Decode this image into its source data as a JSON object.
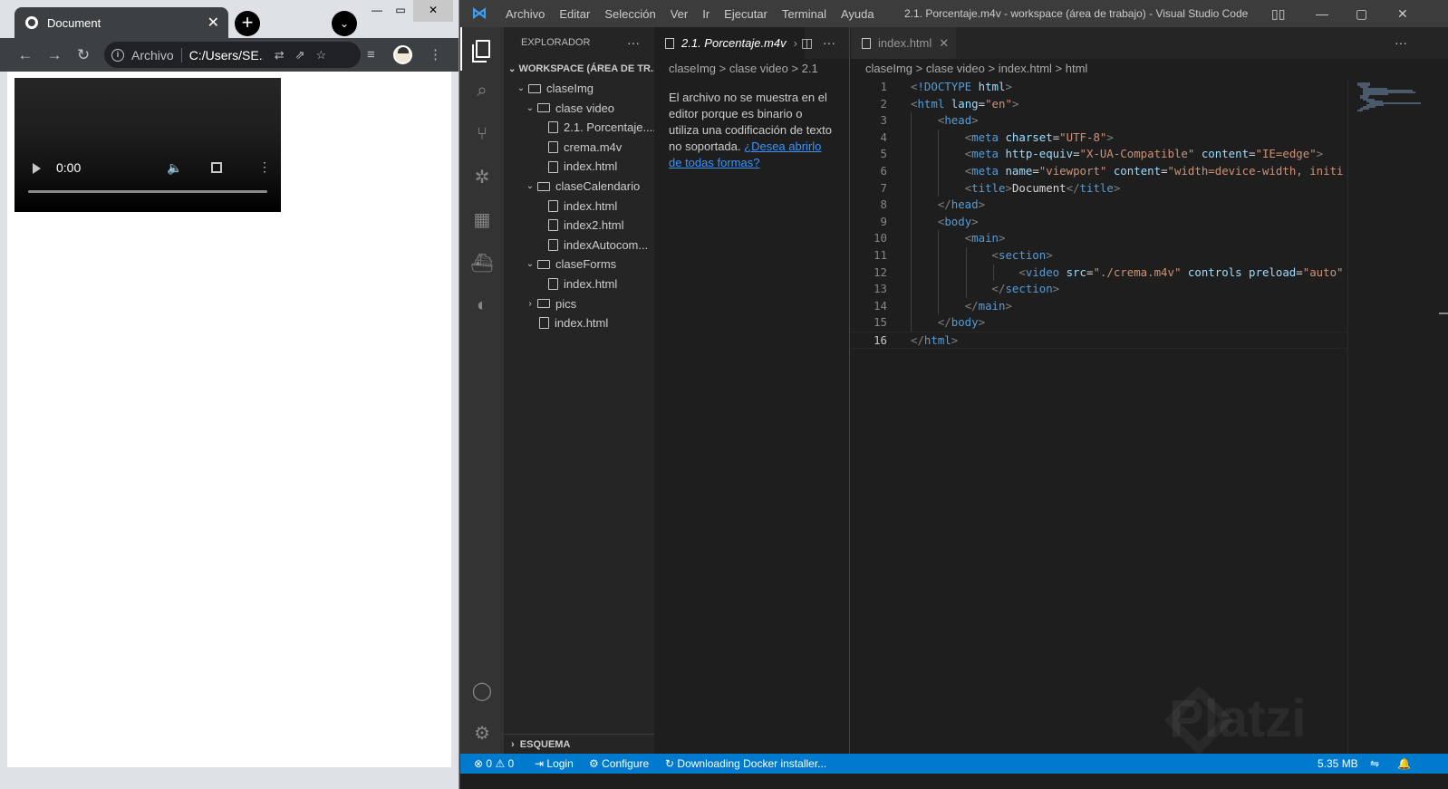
{
  "browser": {
    "tab_title": "Document",
    "address_label": "Archivo",
    "address_url": "C:/Users/SE...",
    "video": {
      "time": "0:00"
    }
  },
  "vscode": {
    "menu": [
      "Archivo",
      "Editar",
      "Selección",
      "Ver",
      "Ir",
      "Ejecutar",
      "Terminal",
      "Ayuda"
    ],
    "window_title": "2.1. Porcentaje.m4v - workspace (área de trabajo) - Visual Studio Code",
    "explorer": {
      "title": "EXPLORADOR",
      "workspace": "WORKSPACE (ÁREA DE TR...",
      "tree": [
        {
          "label": "claseImg",
          "type": "root-folder",
          "depth": 0,
          "chevron": "down"
        },
        {
          "label": "clase video",
          "type": "folder",
          "depth": 1,
          "chevron": "down"
        },
        {
          "label": "2.1. Porcentaje....",
          "type": "file",
          "depth": 2
        },
        {
          "label": "crema.m4v",
          "type": "file",
          "depth": 2
        },
        {
          "label": "index.html",
          "type": "file",
          "depth": 2
        },
        {
          "label": "claseCalendario",
          "type": "folder",
          "depth": 1,
          "chevron": "down"
        },
        {
          "label": "index.html",
          "type": "file",
          "depth": 2
        },
        {
          "label": "index2.html",
          "type": "file",
          "depth": 2
        },
        {
          "label": "indexAutocom...",
          "type": "file",
          "depth": 2
        },
        {
          "label": "claseForms",
          "type": "folder",
          "depth": 1,
          "chevron": "down"
        },
        {
          "label": "index.html",
          "type": "file",
          "depth": 2
        },
        {
          "label": "pics",
          "type": "folder",
          "depth": 1,
          "chevron": "right"
        },
        {
          "label": "index.html",
          "type": "file",
          "depth": 1
        }
      ],
      "outline": "ESQUEMA"
    },
    "group1": {
      "tab": "2.1. Porcentaje.m4v",
      "breadcrumb": "claseImg > clase video > 2.1",
      "message": "El archivo no se muestra en el editor porque es binario o utiliza una codificación de texto no soportada.",
      "link": "¿Desea abrirlo de todas formas?"
    },
    "group2": {
      "tab": "index.html",
      "breadcrumb": "claseImg > clase video > index.html > html",
      "code": [
        [
          {
            "c": "p",
            "t": "<"
          },
          {
            "c": "t",
            "t": "!DOCTYPE"
          },
          {
            "c": "a",
            "t": " html"
          },
          {
            "c": "p",
            "t": ">"
          }
        ],
        [
          {
            "c": "p",
            "t": "<"
          },
          {
            "c": "t",
            "t": "html"
          },
          {
            "c": "a",
            "t": " lang"
          },
          {
            "c": "tx2",
            "t": "="
          },
          {
            "c": "s",
            "t": "\"en\""
          },
          {
            "c": "p",
            "t": ">"
          }
        ],
        [
          {
            "c": "tx2",
            "t": "    "
          },
          {
            "c": "p",
            "t": "<"
          },
          {
            "c": "t",
            "t": "head"
          },
          {
            "c": "p",
            "t": ">"
          }
        ],
        [
          {
            "c": "tx2",
            "t": "        "
          },
          {
            "c": "p",
            "t": "<"
          },
          {
            "c": "t",
            "t": "meta"
          },
          {
            "c": "a",
            "t": " charset"
          },
          {
            "c": "tx2",
            "t": "="
          },
          {
            "c": "s",
            "t": "\"UTF-8\""
          },
          {
            "c": "p",
            "t": ">"
          }
        ],
        [
          {
            "c": "tx2",
            "t": "        "
          },
          {
            "c": "p",
            "t": "<"
          },
          {
            "c": "t",
            "t": "meta"
          },
          {
            "c": "a",
            "t": " http-equiv"
          },
          {
            "c": "tx2",
            "t": "="
          },
          {
            "c": "s",
            "t": "\"X-UA-Compatible\""
          },
          {
            "c": "a",
            "t": " content"
          },
          {
            "c": "tx2",
            "t": "="
          },
          {
            "c": "s",
            "t": "\"IE=edge\""
          },
          {
            "c": "p",
            "t": ">"
          }
        ],
        [
          {
            "c": "tx2",
            "t": "        "
          },
          {
            "c": "p",
            "t": "<"
          },
          {
            "c": "t",
            "t": "meta"
          },
          {
            "c": "a",
            "t": " name"
          },
          {
            "c": "tx2",
            "t": "="
          },
          {
            "c": "s",
            "t": "\"viewport\""
          },
          {
            "c": "a",
            "t": " content"
          },
          {
            "c": "tx2",
            "t": "="
          },
          {
            "c": "s",
            "t": "\"width=device-width, initi"
          }
        ],
        [
          {
            "c": "tx2",
            "t": "        "
          },
          {
            "c": "p",
            "t": "<"
          },
          {
            "c": "t",
            "t": "title"
          },
          {
            "c": "p",
            "t": ">"
          },
          {
            "c": "tx2",
            "t": "Document"
          },
          {
            "c": "p",
            "t": "</"
          },
          {
            "c": "t",
            "t": "title"
          },
          {
            "c": "p",
            "t": ">"
          }
        ],
        [
          {
            "c": "tx2",
            "t": "    "
          },
          {
            "c": "p",
            "t": "</"
          },
          {
            "c": "t",
            "t": "head"
          },
          {
            "c": "p",
            "t": ">"
          }
        ],
        [
          {
            "c": "tx2",
            "t": "    "
          },
          {
            "c": "p",
            "t": "<"
          },
          {
            "c": "t",
            "t": "body"
          },
          {
            "c": "p",
            "t": ">"
          }
        ],
        [
          {
            "c": "tx2",
            "t": "        "
          },
          {
            "c": "p",
            "t": "<"
          },
          {
            "c": "t",
            "t": "main"
          },
          {
            "c": "p",
            "t": ">"
          }
        ],
        [
          {
            "c": "tx2",
            "t": "            "
          },
          {
            "c": "p",
            "t": "<"
          },
          {
            "c": "t",
            "t": "section"
          },
          {
            "c": "p",
            "t": ">"
          }
        ],
        [
          {
            "c": "tx2",
            "t": "                "
          },
          {
            "c": "p",
            "t": "<"
          },
          {
            "c": "t",
            "t": "video"
          },
          {
            "c": "a",
            "t": " src"
          },
          {
            "c": "tx2",
            "t": "="
          },
          {
            "c": "s",
            "t": "\"./crema.m4v\""
          },
          {
            "c": "a",
            "t": " controls"
          },
          {
            "c": "a",
            "t": " preload"
          },
          {
            "c": "tx2",
            "t": "="
          },
          {
            "c": "s",
            "t": "\"auto\""
          }
        ],
        [
          {
            "c": "tx2",
            "t": "            "
          },
          {
            "c": "p",
            "t": "</"
          },
          {
            "c": "t",
            "t": "section"
          },
          {
            "c": "p",
            "t": ">"
          }
        ],
        [
          {
            "c": "tx2",
            "t": "        "
          },
          {
            "c": "p",
            "t": "</"
          },
          {
            "c": "t",
            "t": "main"
          },
          {
            "c": "p",
            "t": ">"
          }
        ],
        [
          {
            "c": "tx2",
            "t": "    "
          },
          {
            "c": "p",
            "t": "</"
          },
          {
            "c": "t",
            "t": "body"
          },
          {
            "c": "p",
            "t": ">"
          }
        ],
        [
          {
            "c": "p",
            "t": "</"
          },
          {
            "c": "t",
            "t": "html"
          },
          {
            "c": "p",
            "t": ">"
          }
        ]
      ],
      "current_line": 16
    },
    "status": {
      "errors": "0",
      "warnings": "0",
      "login": "Login",
      "configure": "Configure",
      "docker": "Downloading Docker installer...",
      "size": "5.35 MB"
    },
    "watermark": "Platzi"
  }
}
